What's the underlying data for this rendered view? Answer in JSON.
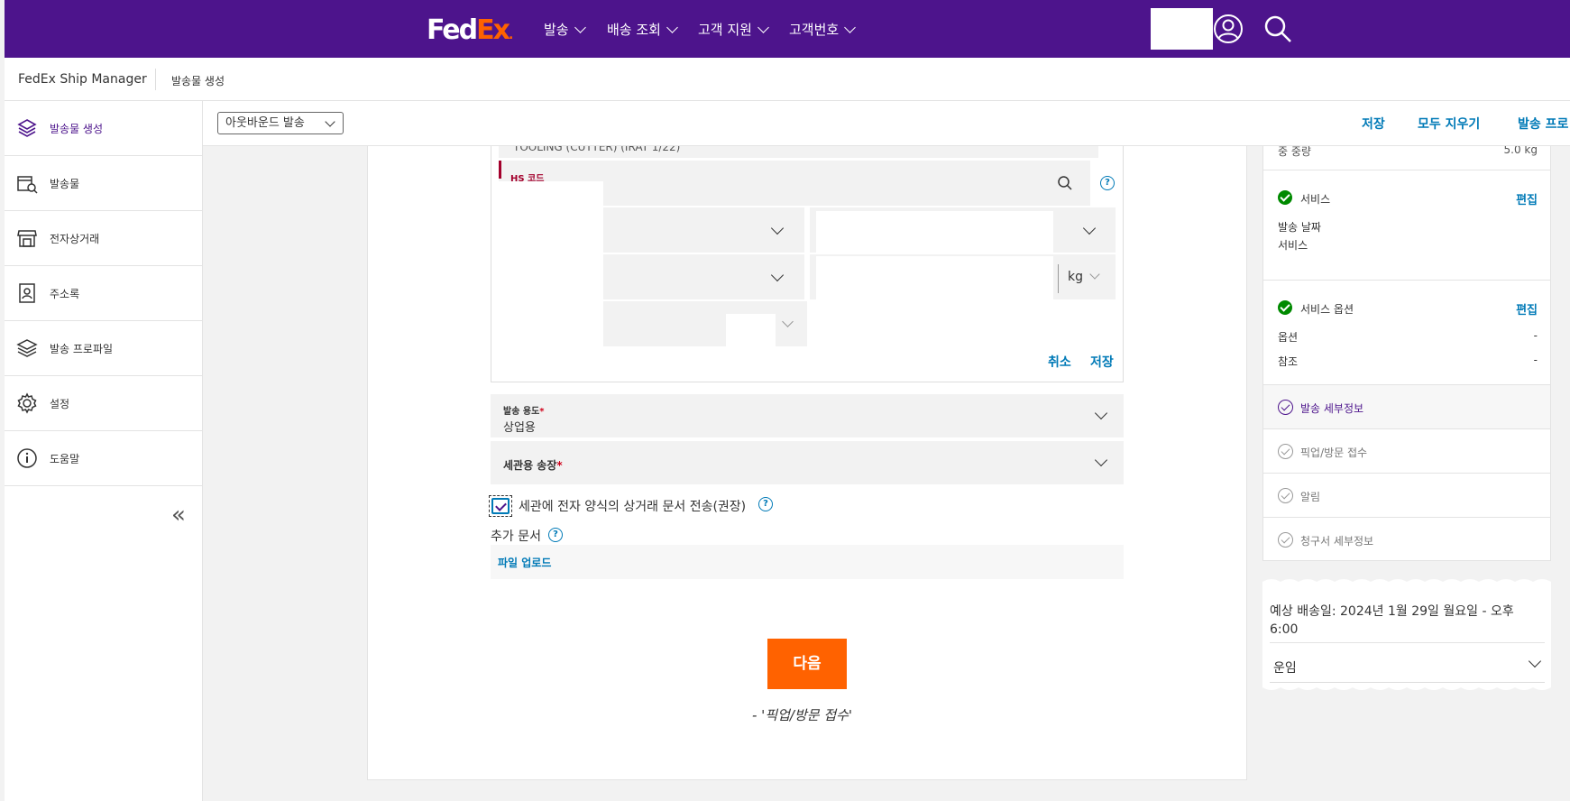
{
  "header": {
    "logo_fed": "Fed",
    "logo_ex": "Ex",
    "logo_dot": ".",
    "nav": [
      "발송",
      "배송 조회",
      "고객 지원",
      "고객번호"
    ]
  },
  "subheader": {
    "app_title": "FedEx Ship Manager",
    "breadcrumb": "발송물 생성"
  },
  "sidebar": {
    "items": [
      {
        "label": "발송물 생성",
        "icon": "box-stack-icon",
        "active": true
      },
      {
        "label": "발송물",
        "icon": "package-search-icon"
      },
      {
        "label": "전자상거래",
        "icon": "storefront-icon"
      },
      {
        "label": "주소록",
        "icon": "address-book-icon"
      },
      {
        "label": "발송 프로파일",
        "icon": "layers-icon"
      },
      {
        "label": "설정",
        "icon": "gear-icon"
      },
      {
        "label": "도움말",
        "icon": "info-icon"
      }
    ],
    "collapse_glyph": "«"
  },
  "toolbar": {
    "ship_type": "아웃바운드 발송",
    "save": "저장",
    "clear_all": "모두 지우기",
    "ship_profile": "발송 프로"
  },
  "form": {
    "clipped_text": "TOOLING (CUTTER) (IRAT 1/22)",
    "hs_code_label": "HS 코드",
    "weight_unit": "kg",
    "cancel": "취소",
    "save": "저장",
    "purpose_label": "발송 용도",
    "purpose_req": "*",
    "purpose_value": "상업용",
    "invoice_label": "세관용 송장",
    "invoice_req": "*",
    "etd_checkbox_label": "세관에 전자 양식의 상거래 문서 전송(권장)",
    "etd_checked": true,
    "additional_docs": "추가 문서",
    "upload_link": "파일 업로드",
    "help_glyph": "?",
    "next_button": "다음",
    "next_hint": "- '픽업/방문 접수'"
  },
  "summary": {
    "top_clipped_left": "중 중량",
    "top_clipped_right": "5.0 kg",
    "service": {
      "title": "서비스",
      "edit": "편집",
      "lines": [
        "발송 날짜",
        "서비스"
      ]
    },
    "service_options": {
      "title": "서비스 옵션",
      "edit": "편집",
      "rows": [
        {
          "label": "옵션",
          "value": "-"
        },
        {
          "label": "참조",
          "value": "-"
        }
      ]
    },
    "steps": [
      {
        "label": "발송 세부정보",
        "state": "current"
      },
      {
        "label": "픽업/방문 접수",
        "state": "pending"
      },
      {
        "label": "알림",
        "state": "pending"
      },
      {
        "label": "청구서 세부정보",
        "state": "pending"
      }
    ]
  },
  "estimate": {
    "delivery_text": "예상 배송일: 2024년 1월 29일 월요일 - 오후 6:00",
    "freight_label": "운임"
  },
  "colors": {
    "fedex_purple": "#4d148c",
    "fedex_orange": "#ff6200",
    "link_blue": "#007ab7",
    "success_green": "#008a00",
    "required_red": "#d0021b"
  }
}
